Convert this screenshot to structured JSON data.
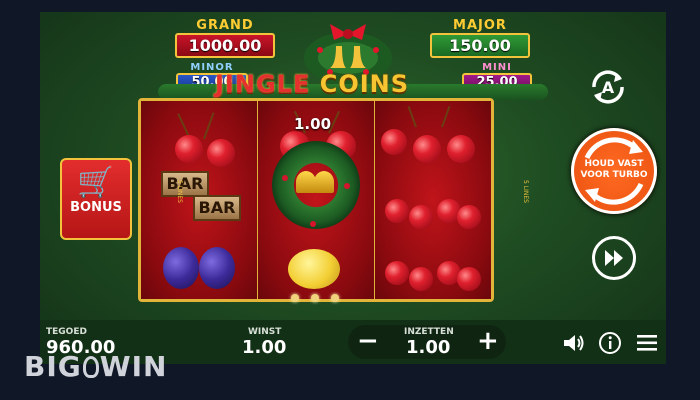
{
  "jackpots": {
    "grand": {
      "label": "GRAND",
      "value": "1000.00"
    },
    "major": {
      "label": "MAJOR",
      "value": "150.00"
    },
    "minor": {
      "label": "MINOR",
      "value": "50.00"
    },
    "mini": {
      "label": "MINI",
      "value": "25.00"
    }
  },
  "game": {
    "title_left": "JINGLE",
    "title_right": "COINS",
    "coin_value": "1.00",
    "ways_left": "5 LINES",
    "ways_right": "5 LINES",
    "bar_text": "BAR"
  },
  "controls": {
    "bonus_label": "BONUS",
    "spin_label_line1": "HOUD VAST",
    "spin_label_line2": "VOOR TURBO",
    "autoplay_glyph": "A"
  },
  "bottom": {
    "balance_label": "TEGOED",
    "balance_value": "960.00",
    "win_label": "WINST",
    "win_value": "1.00",
    "bet_label": "INZETTEN",
    "bet_value": "1.00",
    "minus": "−",
    "plus": "+"
  },
  "watermark": {
    "left": "BIG",
    "right": "WIN"
  },
  "colors": {
    "spin_button": "#f15a16",
    "reel_frame": "#e2b43a",
    "background": "#1f4d22"
  },
  "icons": [
    "cart-icon",
    "autoplay-icon",
    "turbo-icon",
    "sound-icon",
    "info-icon",
    "menu-icon"
  ]
}
